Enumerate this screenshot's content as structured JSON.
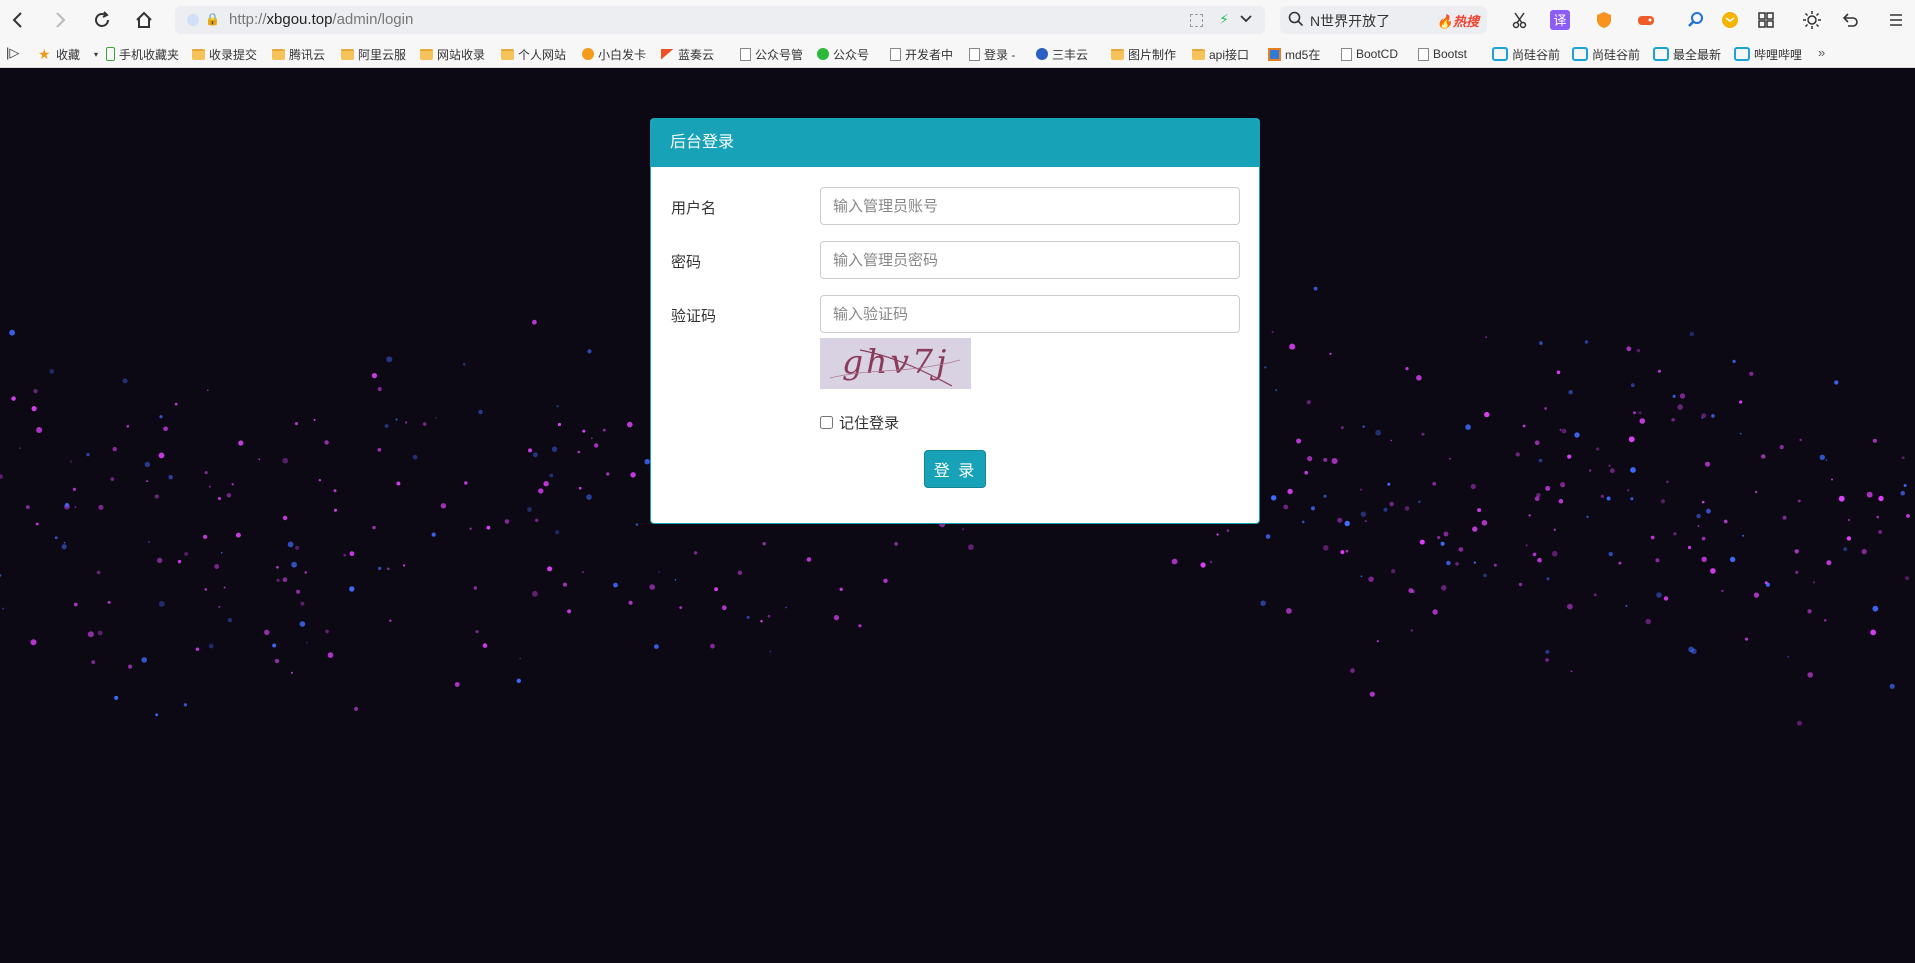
{
  "browser": {
    "url_prefix": "http://",
    "url_host": "xbgou.top",
    "url_path": "/admin/login",
    "search_text": "N世界开放了",
    "search_hot": "热搜",
    "translate_label": "译",
    "more_bookmarks": "»",
    "bookmarks": [
      {
        "label": "收藏",
        "icon": "star-icon"
      },
      {
        "label": "手机收藏夹",
        "icon": "phone-icon"
      },
      {
        "label": "收录提交",
        "icon": "folder-icon"
      },
      {
        "label": "腾讯云",
        "icon": "folder-icon"
      },
      {
        "label": "阿里云服",
        "icon": "folder-icon"
      },
      {
        "label": "网站收录",
        "icon": "folder-icon"
      },
      {
        "label": "个人网站",
        "icon": "folder-icon"
      },
      {
        "label": "小白发卡",
        "icon": "site-icon"
      },
      {
        "label": "蓝奏云",
        "icon": "site-icon"
      },
      {
        "label": "公众号管",
        "icon": "page-icon"
      },
      {
        "label": "公众号",
        "icon": "wechat-icon"
      },
      {
        "label": "开发者中",
        "icon": "page-icon"
      },
      {
        "label": "登录 -",
        "icon": "page-icon"
      },
      {
        "label": "三丰云",
        "icon": "site-icon"
      },
      {
        "label": "图片制作",
        "icon": "folder-icon"
      },
      {
        "label": "api接口",
        "icon": "folder-icon"
      },
      {
        "label": "md5在",
        "icon": "site-icon"
      },
      {
        "label": "BootCD",
        "icon": "page-icon"
      },
      {
        "label": "Bootst",
        "icon": "page-icon"
      },
      {
        "label": "尚硅谷前",
        "icon": "bilibili-icon"
      },
      {
        "label": "尚硅谷前",
        "icon": "bilibili-icon"
      },
      {
        "label": "最全最新",
        "icon": "bilibili-icon"
      },
      {
        "label": "哔哩哔哩",
        "icon": "bilibili-icon"
      }
    ]
  },
  "login": {
    "title": "后台登录",
    "username_label": "用户名",
    "username_placeholder": "输入管理员账号",
    "password_label": "密码",
    "password_placeholder": "输入管理员密码",
    "captcha_label": "验证码",
    "captcha_placeholder": "输入验证码",
    "captcha_text": "ghv7j",
    "remember_label": "记住登录",
    "submit_label": "登 录"
  },
  "colors": {
    "accent": "#17a2b8",
    "background": "#0c0915",
    "particle_pink": "#e040fb",
    "particle_blue": "#3f6bff"
  }
}
